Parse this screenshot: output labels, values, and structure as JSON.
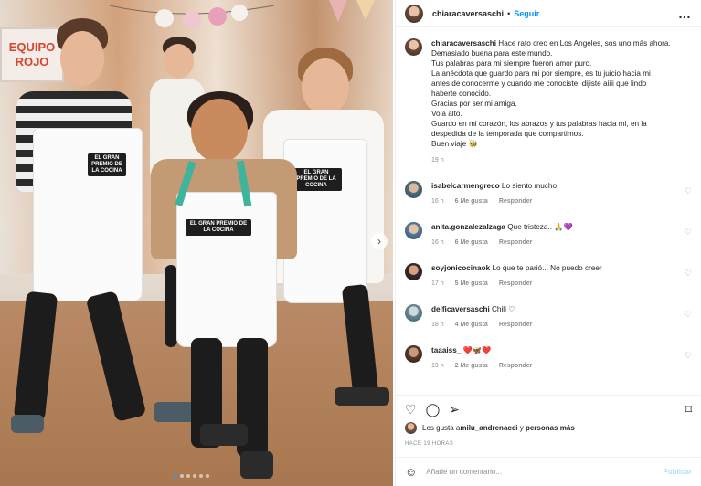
{
  "post": {
    "image_sign_line1": "EQUIPO",
    "image_sign_line2": "ROJO",
    "apron_badges": [
      "EL GRAN PREMIO DE LA COCINA",
      "EL GRAN PREMIO DE LA COCINA",
      "EL GRAN PREMIO DE LA COCINA"
    ],
    "carousel_next": "›",
    "slide_count": 6,
    "active_slide": 1
  },
  "header": {
    "username": "chiaracaversaschi",
    "separator": "•",
    "follow_label": "Seguir",
    "more_icon": "…"
  },
  "caption": {
    "username": "chiaracaversaschi",
    "lines": [
      "Hace rato creo en Los Angeles, sos uno más ahora.",
      "Demasiado buena para este mundo.",
      "Tus palabras para mi siempre fueron amor puro.",
      "La anécdota que guardo para mi por siempre, es tu juicio hacia mi antes de conocerme y cuando me conociste, dijiste aiiii que lindo haberte conocido.",
      "Gracias por ser mi amiga.",
      "Volá alto.",
      "Guardo en mi corazón, los abrazos y tus palabras hacia mi, en la despedida de la temporada que compartimos.",
      "Buen viaje 🐝"
    ],
    "time": "19 h"
  },
  "comments": [
    {
      "username": "isabelcarmengreco",
      "text": "Lo siento mucho",
      "time": "16 h",
      "likes": "6 Me gusta",
      "reply": "Responder"
    },
    {
      "username": "anita.gonzalezalzaga",
      "text": "Que tristeza.. 🙏💜",
      "time": "16 h",
      "likes": "6 Me gusta",
      "reply": "Responder"
    },
    {
      "username": "soyjonicocinaok",
      "text": "Lo que te parió... No puedo creer",
      "time": "17 h",
      "likes": "5 Me gusta",
      "reply": "Responder"
    },
    {
      "username": "delficaversaschi",
      "text": "Chili ♡",
      "time": "18 h",
      "likes": "4 Me gusta",
      "reply": "Responder"
    },
    {
      "username": "taaaiss_",
      "text": "❤️🦋❤️",
      "time": "19 h",
      "likes": "2 Me gusta",
      "reply": "Responder"
    }
  ],
  "actions": {
    "like_icon": "♡",
    "comment_icon": "◯",
    "share_icon": "➢",
    "save_icon": "⌑"
  },
  "likes": {
    "prefix": "Les gusta a ",
    "user": "milu_andrenacci",
    "middle": " y ",
    "others": "personas más"
  },
  "time_ago": "HACE 19 HORAS",
  "add_comment": {
    "emoji_icon": "☺",
    "placeholder": "Añade un comentario...",
    "publish_label": "Publicar"
  }
}
